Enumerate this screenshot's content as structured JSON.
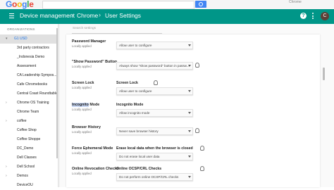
{
  "browser": {
    "logo_text": "Google",
    "top_link": "Chrome"
  },
  "header": {
    "breadcrumbs": [
      "Device management",
      "Chrome",
      "User Settings"
    ],
    "help_label": "?",
    "avatar_letter": "C"
  },
  "sidebar": {
    "heading": "ORGANIZATIONS",
    "items": [
      {
        "label": "G1 USD",
        "selected": true,
        "expand": "▾"
      },
      {
        "label": "3rd party contractors",
        "selected": false,
        "expand": ""
      },
      {
        "label": "_Indonesia Demo",
        "selected": false,
        "expand": ""
      },
      {
        "label": "Assessment",
        "selected": false,
        "expand": ""
      },
      {
        "label": "CA Leadership Sympos...",
        "selected": false,
        "expand": ""
      },
      {
        "label": "Cafe Chromebooks",
        "selected": false,
        "expand": ""
      },
      {
        "label": "Central Coast Roundtable",
        "selected": false,
        "expand": ""
      },
      {
        "label": "Chrome OS Training",
        "selected": false,
        "expand": "›"
      },
      {
        "label": "Chrome Team",
        "selected": false,
        "expand": ""
      },
      {
        "label": "coffee",
        "selected": false,
        "expand": "›"
      },
      {
        "label": "Coffee Shop",
        "selected": false,
        "expand": ""
      },
      {
        "label": "Coffee Shoppe",
        "selected": false,
        "expand": ""
      },
      {
        "label": "DC_Demo",
        "selected": false,
        "expand": ""
      },
      {
        "label": "Dell Classes",
        "selected": false,
        "expand": ""
      },
      {
        "label": "Dell School",
        "selected": false,
        "expand": "›"
      },
      {
        "label": "Demos",
        "selected": false,
        "expand": "›"
      },
      {
        "label": "DeviceOU",
        "selected": false,
        "expand": ""
      }
    ]
  },
  "main": {
    "search_placeholder": "Search settings",
    "rows": [
      {
        "title": "Password Manager",
        "subtitle": "Locally applied",
        "setting_label": "",
        "value": "Allow user to configure",
        "bulb": false
      },
      {
        "title": "\"Show Password\" Button",
        "subtitle": "Locally applied",
        "setting_label": "",
        "value": "Always show \"show password\" button in passw...",
        "bulb": true
      },
      {
        "title": "Screen Lock",
        "subtitle": "Locally applied",
        "setting_label": "Screen Lock",
        "value": "Allow user to configure",
        "bulb": true
      },
      {
        "title": "Incognito Mode",
        "title_highlight": "Incognito",
        "title_rest": " Mode",
        "subtitle": "Locally applied",
        "setting_label": "Incognito Mode",
        "value": "Allow incognito mode",
        "bulb": false
      },
      {
        "title": "Browser History",
        "subtitle": "Locally applied",
        "setting_label": "",
        "value": "Never save browser history",
        "bulb": true
      },
      {
        "title": "Force Ephemeral Mode",
        "subtitle": "Locally applied",
        "setting_label": "Erase local data when the browser is closed",
        "value": "Do not erase local user data",
        "bulb": true
      },
      {
        "title": "Online Revocation Checks",
        "subtitle": "Locally applied",
        "setting_label": "Online OCSP/CRL Checks",
        "value": "Do not perform online OCSP/CRL checks",
        "bulb": true
      }
    ]
  }
}
